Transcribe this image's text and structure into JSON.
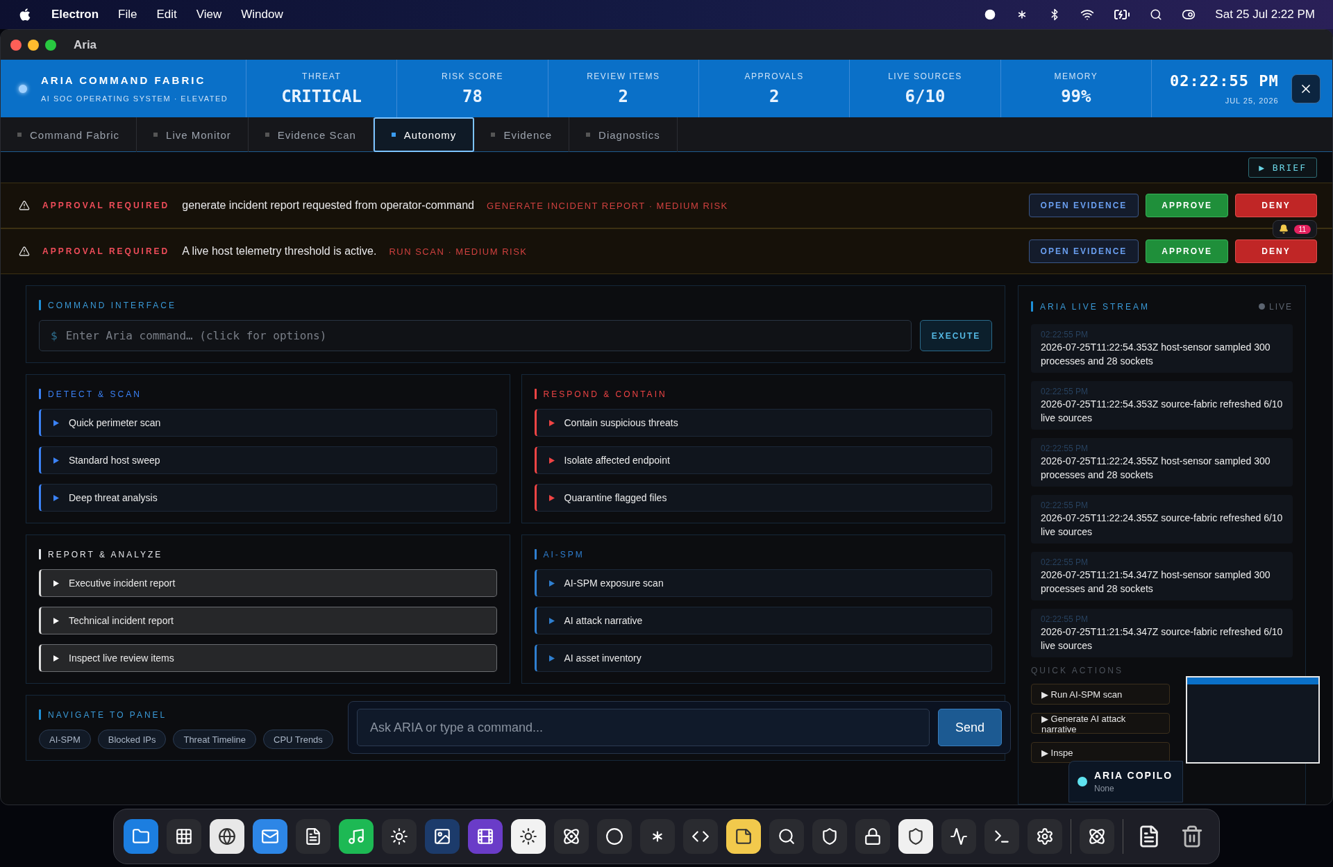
{
  "menu_bar": {
    "app": "Electron",
    "menus": [
      "File",
      "Edit",
      "View",
      "Window"
    ],
    "clock": "Sat 25 Jul  2:22 PM"
  },
  "window": {
    "title": "Aria"
  },
  "header": {
    "brand": "ARIA COMMAND FABRIC",
    "subtitle": "AI SOC OPERATING SYSTEM · ELEVATED",
    "stats": [
      {
        "label": "THREAT",
        "value": "CRITICAL"
      },
      {
        "label": "RISK SCORE",
        "value": "78"
      },
      {
        "label": "REVIEW ITEMS",
        "value": "2"
      },
      {
        "label": "APPROVALS",
        "value": "2"
      },
      {
        "label": "LIVE SOURCES",
        "value": "6/10"
      },
      {
        "label": "MEMORY",
        "value": "99%"
      }
    ],
    "time": "02:22:55 PM",
    "date": "JUL 25, 2026"
  },
  "tabs": [
    {
      "label": "Command Fabric",
      "selected": false
    },
    {
      "label": "Live Monitor",
      "selected": false
    },
    {
      "label": "Evidence Scan",
      "selected": false
    },
    {
      "label": "Autonomy",
      "selected": true
    },
    {
      "label": "Evidence",
      "selected": false
    },
    {
      "label": "Diagnostics",
      "selected": false
    }
  ],
  "brief_button": "▶ BRIEF",
  "approvals": [
    {
      "tag": "APPROVAL REQUIRED",
      "message": "generate incident report requested from operator-command",
      "detail": "GENERATE INCIDENT REPORT · MEDIUM RISK",
      "buttons": [
        "OPEN EVIDENCE",
        "APPROVE",
        "DENY"
      ]
    },
    {
      "tag": "APPROVAL REQUIRED",
      "message": "A live host telemetry threshold is active.",
      "detail": "RUN SCAN · MEDIUM RISK",
      "buttons": [
        "OPEN EVIDENCE",
        "APPROVE",
        "DENY"
      ]
    }
  ],
  "notifications": {
    "count": "11"
  },
  "command_interface": {
    "title": "COMMAND INTERFACE",
    "prompt": "$",
    "placeholder": "Enter Aria command… (click for options)",
    "button": "EXECUTE"
  },
  "groups": [
    {
      "title": "DETECT & SCAN",
      "color": "#3b82f6",
      "items": [
        "Quick perimeter scan",
        "Standard host sweep",
        "Deep threat analysis"
      ]
    },
    {
      "title": "RESPOND & CONTAIN",
      "color": "#ef4444",
      "items": [
        "Contain suspicious threats",
        "Isolate affected endpoint",
        "Quarantine flagged files"
      ]
    },
    {
      "title": "REPORT & ANALYZE",
      "color": "#e5e7eb",
      "items": [
        "Executive incident report",
        "Technical incident report",
        "Inspect live review items"
      ]
    },
    {
      "title": "AI-SPM",
      "color": "#2f7fd0",
      "items": [
        "AI-SPM exposure scan",
        "AI attack narrative",
        "AI asset inventory"
      ]
    }
  ],
  "navigate": {
    "title": "NAVIGATE TO PANEL",
    "chips": [
      "AI-SPM",
      "Blocked IPs",
      "Threat Timeline",
      "CPU Trends"
    ]
  },
  "chat": {
    "placeholder": "Ask ARIA or type a command...",
    "button": "Send"
  },
  "live_stream": {
    "title": "ARIA LIVE STREAM",
    "status": "LIVE",
    "entries": [
      {
        "time": "02:22:55 PM",
        "text": "2026-07-25T11:22:54.353Z host-sensor sampled 300 processes and 28 sockets"
      },
      {
        "time": "02:22:55 PM",
        "text": "2026-07-25T11:22:54.353Z source-fabric refreshed 6/10 live sources"
      },
      {
        "time": "02:22:55 PM",
        "text": "2026-07-25T11:22:24.355Z host-sensor sampled 300 processes and 28 sockets"
      },
      {
        "time": "02:22:55 PM",
        "text": "2026-07-25T11:22:24.355Z source-fabric refreshed 6/10 live sources"
      },
      {
        "time": "02:22:55 PM",
        "text": "2026-07-25T11:21:54.347Z host-sensor sampled 300 processes and 28 sockets"
      },
      {
        "time": "02:22:55 PM",
        "text": "2026-07-25T11:21:54.347Z source-fabric refreshed 6/10 live sources"
      }
    ]
  },
  "quick_actions": {
    "title": "QUICK ACTIONS",
    "items": [
      "▶ Run AI-SPM scan",
      "▶ Generate AI attack narrative",
      "▶ Inspe"
    ]
  },
  "copilot": {
    "title": "ARIA COPILO",
    "status": "None"
  }
}
